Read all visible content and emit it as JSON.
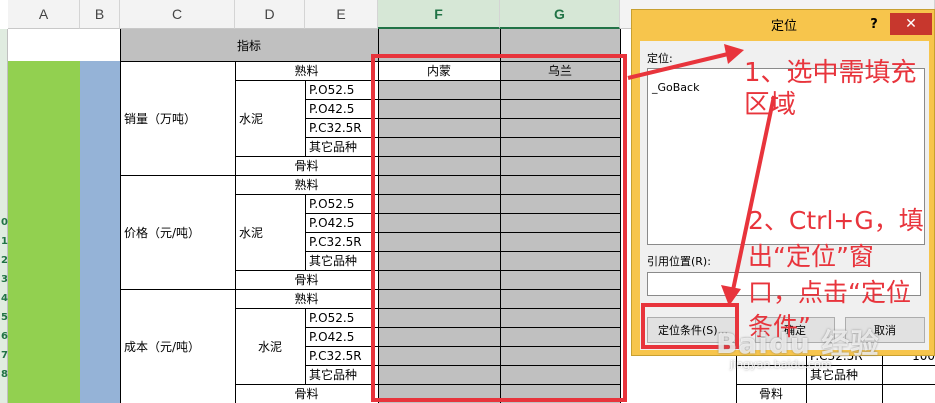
{
  "columns": {
    "a": "A",
    "b": "B",
    "c": "C",
    "d": "D",
    "e": "E",
    "f": "F",
    "g": "G"
  },
  "row_numbers": [
    "0",
    "1",
    "2",
    "3",
    "4",
    "5",
    "6",
    "7",
    "8"
  ],
  "table": {
    "header": "指标",
    "col_f": "内蒙",
    "col_g": "乌兰",
    "groups": [
      "销量（万吨）",
      "价格（元/吨）",
      "成本（元/吨）"
    ],
    "clinker": "熟料",
    "cement": "水泥",
    "aggregate": "骨料",
    "grade1": "P.O52.5",
    "grade2": "P.O42.5",
    "grade3": "P.C32.5R",
    "other": "其它品种"
  },
  "dialog": {
    "title": "定位",
    "help": "?",
    "close": "✕",
    "goto_label": "定位:",
    "list_item": "_GoBack",
    "ref_label": "引用位置(R):",
    "special_button": "定位条件(S)...",
    "ok_button": "确定",
    "cancel_button": "取消"
  },
  "annotations": {
    "step1_line1": "1、选中需填充",
    "step1_line2": "区域",
    "step2_line1": "2、Ctrl+G，填",
    "step2_line2": "出“定位”窗",
    "step2_line3": "口，点击“定位",
    "step2_line4": "条件”"
  },
  "background_right": {
    "cell1": "P.C32.5R",
    "cell2": "其它品种",
    "cell3": "骨料",
    "cell4": "100"
  },
  "watermark": {
    "text": "Baidu 经验",
    "sub": "jingyan.baidu.com"
  },
  "colors": {
    "red": "#e8343c",
    "green_fill": "#92d050",
    "blue_fill": "#95b3d7",
    "gray_fill": "#c0c0c0",
    "dialog_frame": "#f7c54c"
  }
}
